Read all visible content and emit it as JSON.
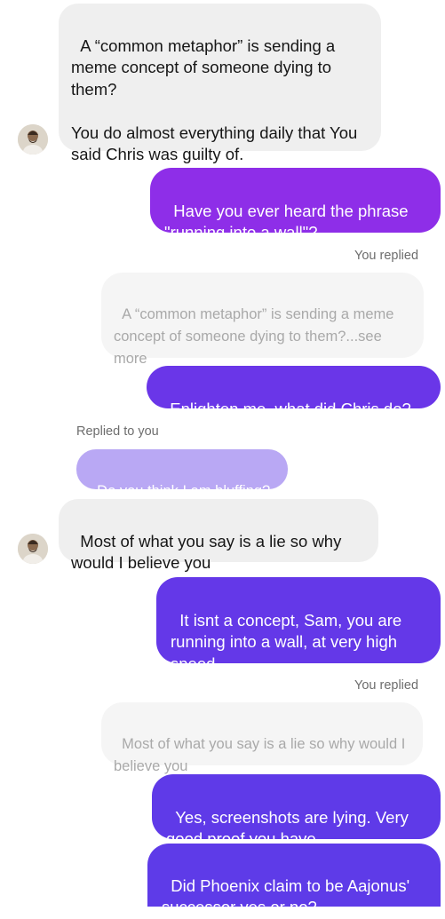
{
  "messages": {
    "m1": "A “common metaphor” is sending a meme concept of someone dying to them?\n\nYou do almost everything daily that You said Chris was guilty of.",
    "m2": "Have you ever heard the phrase \"running into a wall\"?",
    "m3_label": "You replied",
    "m3_quote": "A “common metaphor” is sending a meme concept of someone dying to them?...see more",
    "m4": "Enlighten me, what did Chris do?",
    "m5_label": "Replied to you",
    "m5_quote": "Do you think I am bluffing?",
    "m6": "Most of what you say is a lie so why would I believe you",
    "m7": "It isnt a concept, Sam, you are running into a wall, at very high speed",
    "m8_label": "You replied",
    "m8_quote": "Most of what you say is a lie so why would I believe you",
    "m9": "Yes, screenshots are lying. Very good proof you have.",
    "m10": "Did Phoenix claim to be Aajonus' successor yes or no?"
  },
  "colors": {
    "outgoing_purple": "#8e2ee8",
    "outgoing_violet": "#6438e8",
    "incoming_bg": "#efefef",
    "reply_preview_bg": "#b9a8f4"
  },
  "icons": {
    "avatar": "contact-avatar-icon"
  }
}
